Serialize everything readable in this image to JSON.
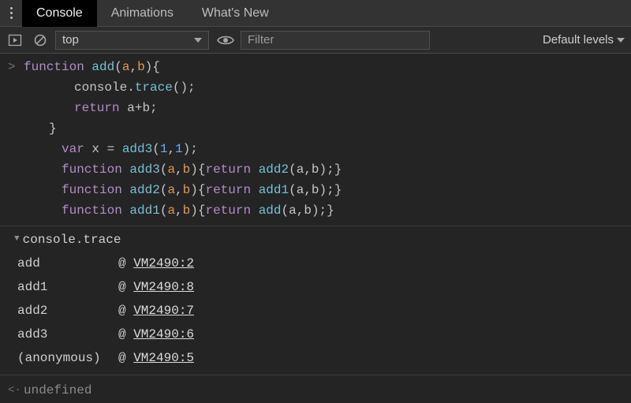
{
  "tabs": {
    "items": [
      "Console",
      "Animations",
      "What's New"
    ],
    "activeIndex": 0
  },
  "toolbar": {
    "context": "top",
    "filterPlaceholder": "Filter",
    "levels": "Default levels"
  },
  "input": {
    "lines": [
      {
        "indent": "none",
        "tokens": [
          {
            "t": "kw",
            "v": "function "
          },
          {
            "t": "fn",
            "v": "add"
          },
          {
            "t": "brk",
            "v": "("
          },
          {
            "t": "par",
            "v": "a"
          },
          {
            "t": "brk",
            "v": ","
          },
          {
            "t": "par",
            "v": "b"
          },
          {
            "t": "brk",
            "v": "){"
          }
        ]
      },
      {
        "indent": "ind1",
        "tokens": [
          {
            "t": "id",
            "v": "console"
          },
          {
            "t": "op",
            "v": "."
          },
          {
            "t": "prop",
            "v": "trace"
          },
          {
            "t": "brk",
            "v": "();"
          }
        ]
      },
      {
        "indent": "ind1",
        "tokens": [
          {
            "t": "kw",
            "v": "return "
          },
          {
            "t": "id",
            "v": "a"
          },
          {
            "t": "op",
            "v": "+"
          },
          {
            "t": "id",
            "v": "b"
          },
          {
            "t": "brk",
            "v": ";"
          }
        ]
      },
      {
        "indent": "ind2",
        "tokens": [
          {
            "t": "brk",
            "v": "}"
          }
        ]
      },
      {
        "indent": "ind-sub",
        "tokens": [
          {
            "t": "kw",
            "v": "var "
          },
          {
            "t": "id",
            "v": "x "
          },
          {
            "t": "op",
            "v": "= "
          },
          {
            "t": "fn",
            "v": "add3"
          },
          {
            "t": "brk",
            "v": "("
          },
          {
            "t": "num",
            "v": "1"
          },
          {
            "t": "brk",
            "v": ","
          },
          {
            "t": "num",
            "v": "1"
          },
          {
            "t": "brk",
            "v": ");"
          }
        ]
      },
      {
        "indent": "ind-sub",
        "tokens": [
          {
            "t": "kw",
            "v": "function "
          },
          {
            "t": "fn",
            "v": "add3"
          },
          {
            "t": "brk",
            "v": "("
          },
          {
            "t": "par",
            "v": "a"
          },
          {
            "t": "brk",
            "v": ","
          },
          {
            "t": "par",
            "v": "b"
          },
          {
            "t": "brk",
            "v": "){"
          },
          {
            "t": "kw",
            "v": "return "
          },
          {
            "t": "fn",
            "v": "add2"
          },
          {
            "t": "brk",
            "v": "("
          },
          {
            "t": "id",
            "v": "a"
          },
          {
            "t": "brk",
            "v": ","
          },
          {
            "t": "id",
            "v": "b"
          },
          {
            "t": "brk",
            "v": ");}"
          }
        ]
      },
      {
        "indent": "ind-sub",
        "tokens": [
          {
            "t": "kw",
            "v": "function "
          },
          {
            "t": "fn",
            "v": "add2"
          },
          {
            "t": "brk",
            "v": "("
          },
          {
            "t": "par",
            "v": "a"
          },
          {
            "t": "brk",
            "v": ","
          },
          {
            "t": "par",
            "v": "b"
          },
          {
            "t": "brk",
            "v": "){"
          },
          {
            "t": "kw",
            "v": "return "
          },
          {
            "t": "fn",
            "v": "add1"
          },
          {
            "t": "brk",
            "v": "("
          },
          {
            "t": "id",
            "v": "a"
          },
          {
            "t": "brk",
            "v": ","
          },
          {
            "t": "id",
            "v": "b"
          },
          {
            "t": "brk",
            "v": ");}"
          }
        ]
      },
      {
        "indent": "ind-sub",
        "tokens": [
          {
            "t": "kw",
            "v": "function "
          },
          {
            "t": "fn",
            "v": "add1"
          },
          {
            "t": "brk",
            "v": "("
          },
          {
            "t": "par",
            "v": "a"
          },
          {
            "t": "brk",
            "v": ","
          },
          {
            "t": "par",
            "v": "b"
          },
          {
            "t": "brk",
            "v": "){"
          },
          {
            "t": "kw",
            "v": "return "
          },
          {
            "t": "fn",
            "v": "add"
          },
          {
            "t": "brk",
            "v": "("
          },
          {
            "t": "id",
            "v": "a"
          },
          {
            "t": "brk",
            "v": ","
          },
          {
            "t": "id",
            "v": "b"
          },
          {
            "t": "brk",
            "v": ");}"
          }
        ]
      }
    ]
  },
  "trace": {
    "heading": "console.trace",
    "frames": [
      {
        "fn": "add",
        "loc": "VM2490:2"
      },
      {
        "fn": "add1",
        "loc": "VM2490:8"
      },
      {
        "fn": "add2",
        "loc": "VM2490:7"
      },
      {
        "fn": "add3",
        "loc": "VM2490:6"
      },
      {
        "fn": "(anonymous)",
        "loc": "VM2490:5"
      }
    ]
  },
  "result": {
    "value": "undefined"
  },
  "gutters": {
    "input": ">",
    "output": "<·"
  }
}
